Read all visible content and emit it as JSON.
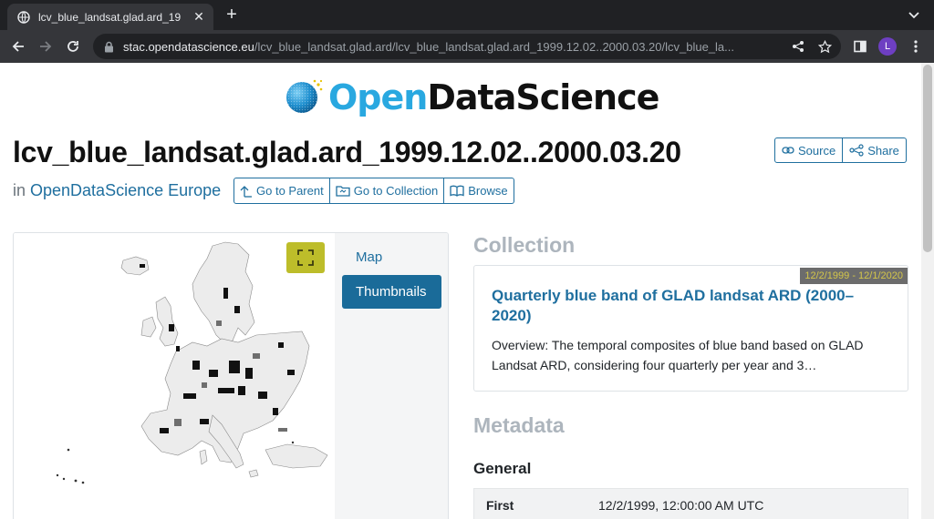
{
  "browser": {
    "tab_title": "lcv_blue_landsat.glad.ard_19",
    "url_host": "stac.opendatascience.eu",
    "url_path": "/lcv_blue_landsat.glad.ard/lcv_blue_landsat.glad.ard_1999.12.02..2000.03.20/lcv_blue_la...",
    "profile_initial": "L"
  },
  "logo": {
    "open": "Open",
    "rest": "DataScience"
  },
  "page": {
    "title": "lcv_blue_landsat.glad.ard_1999.12.02..2000.03.20",
    "in_prefix": "in ",
    "in_link": "OpenDataScience Europe",
    "source_label": "Source",
    "share_label": "Share",
    "go_parent": "Go to Parent",
    "go_collection": "Go to Collection",
    "browse": "Browse"
  },
  "map_panel": {
    "tabs": [
      "Map",
      "Thumbnails"
    ],
    "active_tab": "Thumbnails"
  },
  "collection": {
    "heading": "Collection",
    "date_range": "12/2/1999 - 12/1/2020",
    "title": "Quarterly blue band of GLAD landsat ARD (2000–2020)",
    "description": "Overview: The temporal composites of blue band based on GLAD Landsat ARD, considering four quarterly per year and 3…"
  },
  "metadata": {
    "heading": "Metadata",
    "section": "General",
    "rows": [
      {
        "key": "First",
        "value": "12/2/1999, 12:00:00 AM UTC"
      }
    ]
  }
}
